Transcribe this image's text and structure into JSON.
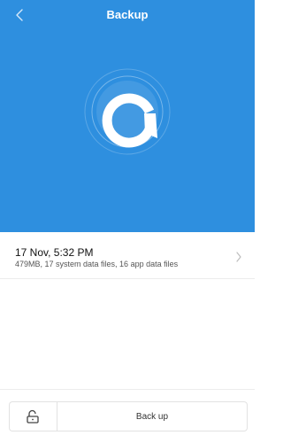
{
  "header": {
    "title": "Backup",
    "background_color": "#2e8fdf",
    "back_icon": "chevron-left-icon",
    "logo_icon": "backup-logo-icon"
  },
  "backup_list": [
    {
      "title": "17 Nov, 5:32 PM",
      "details": "479MB, 17 system data files, 16 app data files",
      "chevron_icon": "chevron-right-icon"
    }
  ],
  "footer": {
    "lock_icon": "unlock-icon",
    "backup_label": "Back up"
  }
}
